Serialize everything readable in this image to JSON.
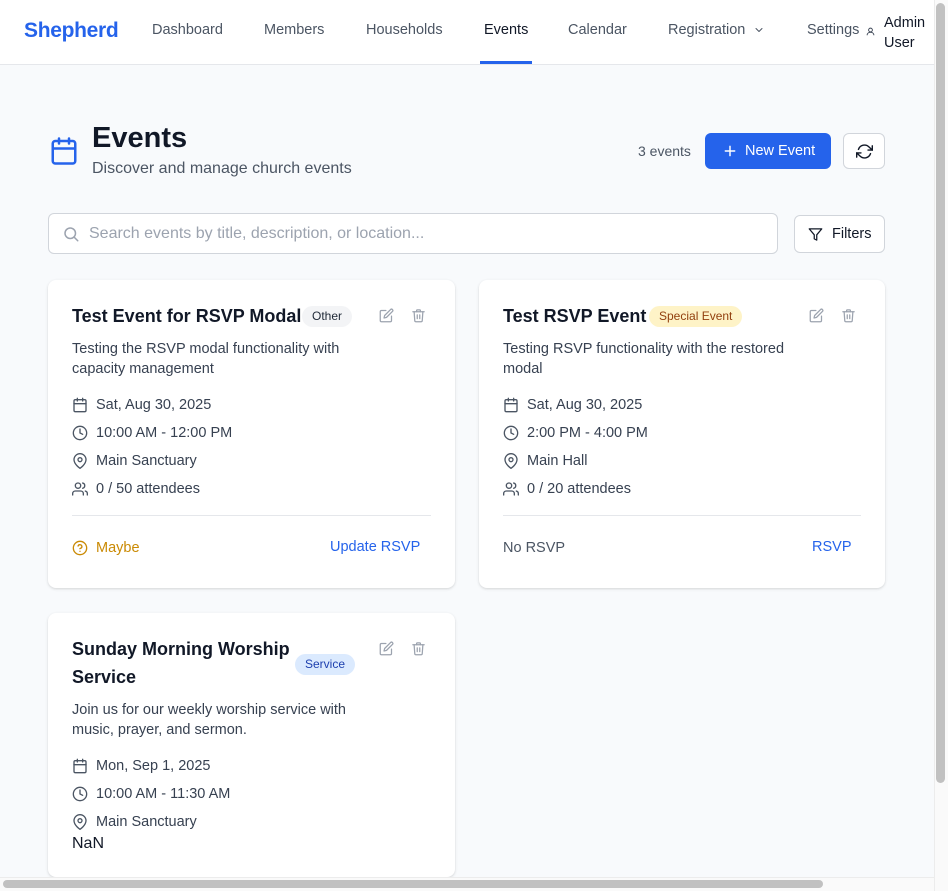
{
  "nav": {
    "brand": "Shepherd",
    "links": [
      "Dashboard",
      "Members",
      "Households",
      "Events",
      "Calendar",
      "Registration",
      "Settings"
    ],
    "active": "Events",
    "user_line1": "Admin",
    "user_line2": "User"
  },
  "header": {
    "title": "Events",
    "subtitle": "Discover and manage church events",
    "count": "3 events",
    "new_event_label": "New Event"
  },
  "search": {
    "placeholder": "Search events by title, description, or location...",
    "value": "",
    "filters_label": "Filters"
  },
  "events": [
    {
      "title": "Test Event for RSVP Modal",
      "category": "Other",
      "description": "Testing the RSVP modal functionality with capacity management",
      "date": "Sat, Aug 30, 2025",
      "time": "10:00 AM - 12:00 PM",
      "location": "Main Sanctuary",
      "attendees": "0 / 50 attendees",
      "rsvp_status": "Maybe",
      "rsvp_action": "Update RSVP"
    },
    {
      "title": "Test RSVP Event",
      "category": "Special Event",
      "description": "Testing RSVP functionality with the restored modal",
      "date": "Sat, Aug 30, 2025",
      "time": "2:00 PM - 4:00 PM",
      "location": "Main Hall",
      "attendees": "0 / 20 attendees",
      "rsvp_status": "No RSVP",
      "rsvp_action": "RSVP"
    },
    {
      "title": "Sunday Morning Worship Service",
      "category": "Service",
      "description": "Join us for our weekly worship service with music, prayer, and sermon.",
      "date": "Mon, Sep 1, 2025",
      "time": "10:00 AM - 11:30 AM",
      "location": "Main Sanctuary",
      "attendees": "NaN"
    }
  ],
  "colors": {
    "accent": "#2563eb",
    "maybe": "#ca8a04",
    "text": "#111827",
    "muted": "#4b5563"
  }
}
